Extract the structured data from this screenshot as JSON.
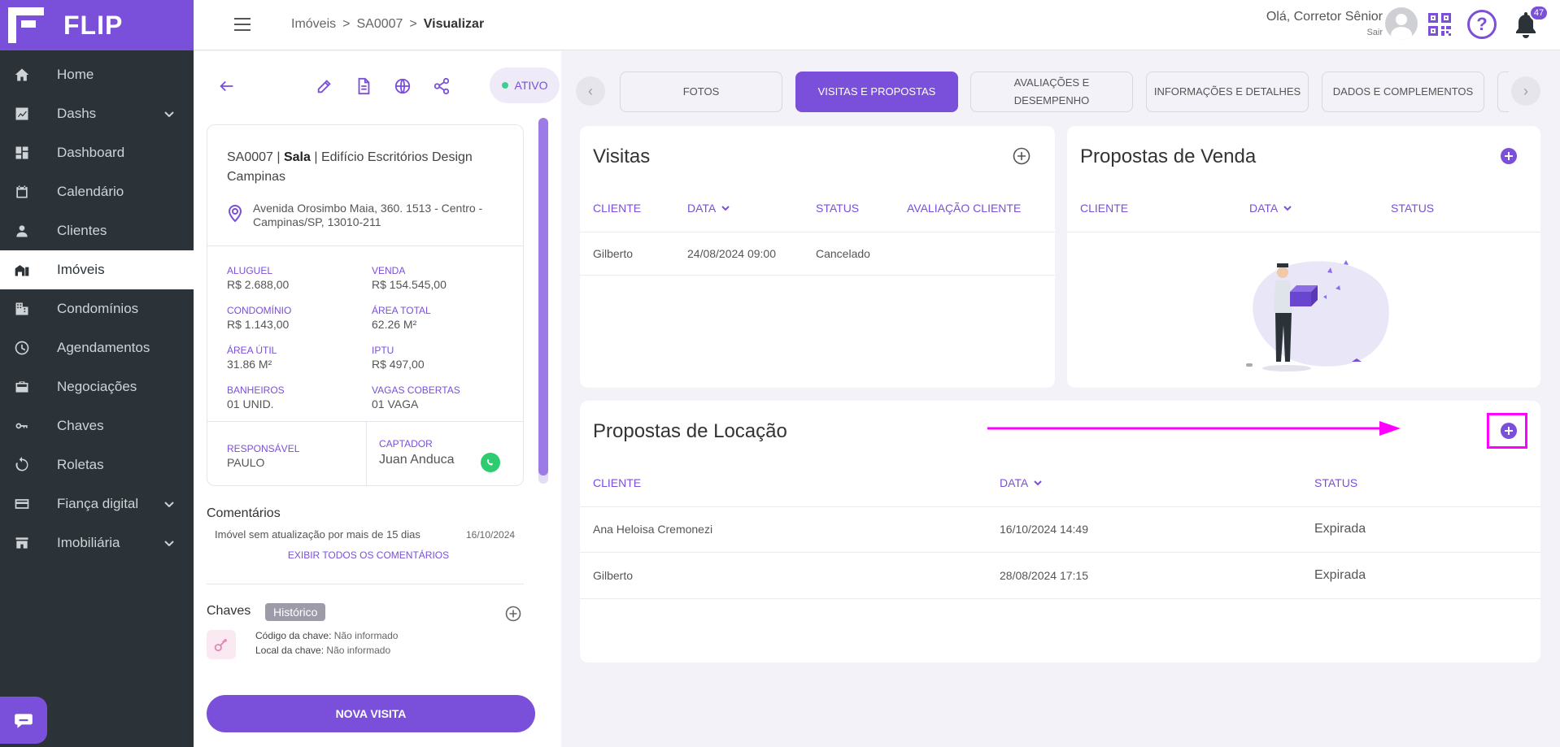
{
  "brand": {
    "name": "FLIP"
  },
  "sidebar": {
    "items": [
      {
        "label": "Home",
        "icon": "home-icon"
      },
      {
        "label": "Dashs",
        "icon": "chart-icon",
        "expandable": true
      },
      {
        "label": "Dashboard",
        "icon": "dashboard-icon"
      },
      {
        "label": "Calendário",
        "icon": "calendar-icon"
      },
      {
        "label": "Clientes",
        "icon": "user-icon"
      },
      {
        "label": "Imóveis",
        "icon": "building-home-icon",
        "active": true
      },
      {
        "label": "Condomínios",
        "icon": "condo-icon"
      },
      {
        "label": "Agendamentos",
        "icon": "clock-icon"
      },
      {
        "label": "Negociações",
        "icon": "briefcase-icon"
      },
      {
        "label": "Chaves",
        "icon": "key-icon"
      },
      {
        "label": "Roletas",
        "icon": "roulette-icon"
      },
      {
        "label": "Fiança digital",
        "icon": "card-icon",
        "expandable": true
      },
      {
        "label": "Imobiliária",
        "icon": "store-icon",
        "expandable": true
      }
    ]
  },
  "topbar": {
    "breadcrumb": [
      "Imóveis",
      "SA0007",
      "Visualizar"
    ],
    "breadcrumb_separator": ">",
    "greeting": "Olá, Corretor Sênior",
    "logout": "Sair",
    "notifications_count": "47",
    "help_symbol": "?"
  },
  "property": {
    "status": "ATIVO",
    "code": "SA0007",
    "type": "Sala",
    "building": "Edifício Escritórios Design Campinas",
    "address_line1": "Avenida Orosimbo Maia, 360. 1513 - Centro -",
    "address_line2": "Campinas/SP, 13010-211",
    "facts": [
      {
        "label": "ALUGUEL",
        "value": "R$ 2.688,00"
      },
      {
        "label": "VENDA",
        "value": "R$ 154.545,00"
      },
      {
        "label": "CONDOMÍNIO",
        "value": "R$ 1.143,00"
      },
      {
        "label": "ÁREA TOTAL",
        "value": "62.26 M²"
      },
      {
        "label": "ÁREA ÚTIL",
        "value": "31.86 M²"
      },
      {
        "label": "IPTU",
        "value": "R$ 497,00"
      },
      {
        "label": "BANHEIROS",
        "value": "01 UNID."
      },
      {
        "label": "VAGAS COBERTAS",
        "value": "01 VAGA"
      }
    ],
    "responsible_label": "RESPONSÁVEL",
    "responsible": "PAULO",
    "captador_label": "CAPTADOR",
    "captador": "Juan Anduca"
  },
  "comments": {
    "title": "Comentários",
    "text": "Imóvel sem atualização por mais de 15 dias",
    "date": "16/10/2024",
    "show_all": "EXIBIR TODOS OS COMENTÁRIOS"
  },
  "keys": {
    "title": "Chaves",
    "history": "Histórico",
    "code_label": "Código da chave:",
    "code_value": "Não informado",
    "place_label": "Local da chave:",
    "place_value": "Não informado"
  },
  "new_visit_button": "NOVA VISITA",
  "tabs": {
    "items": [
      {
        "label": "FOTOS"
      },
      {
        "label": "VISITAS E PROPOSTAS",
        "active": true
      },
      {
        "label": "AVALIAÇÕES E DESEMPENHO"
      },
      {
        "label": "INFORMAÇÕES E DETALHES"
      },
      {
        "label": "DADOS E COMPLEMENTOS"
      }
    ],
    "prev": "‹",
    "next": "›"
  },
  "visitas": {
    "title": "Visitas",
    "columns": [
      "CLIENTE",
      "DATA",
      "STATUS",
      "AVALIAÇÃO CLIENTE"
    ],
    "rows": [
      {
        "cliente": "Gilberto",
        "data": "24/08/2024 09:00",
        "status": "Cancelado",
        "avaliacao": ""
      }
    ]
  },
  "propostas_venda": {
    "title": "Propostas de Venda",
    "columns": [
      "CLIENTE",
      "DATA",
      "STATUS"
    ]
  },
  "propostas_locacao": {
    "title": "Propostas de Locação",
    "columns": [
      "CLIENTE",
      "DATA",
      "STATUS"
    ],
    "rows": [
      {
        "cliente": "Ana Heloisa Cremonezi",
        "data": "16/10/2024 14:49",
        "status": "Expirada"
      },
      {
        "cliente": "Gilberto",
        "data": "28/08/2024 17:15",
        "status": "Expirada"
      }
    ]
  },
  "colors": {
    "accent": "#7a4fd9",
    "sidebar_bg": "#2b3338",
    "annotation": "#ff00ff"
  }
}
